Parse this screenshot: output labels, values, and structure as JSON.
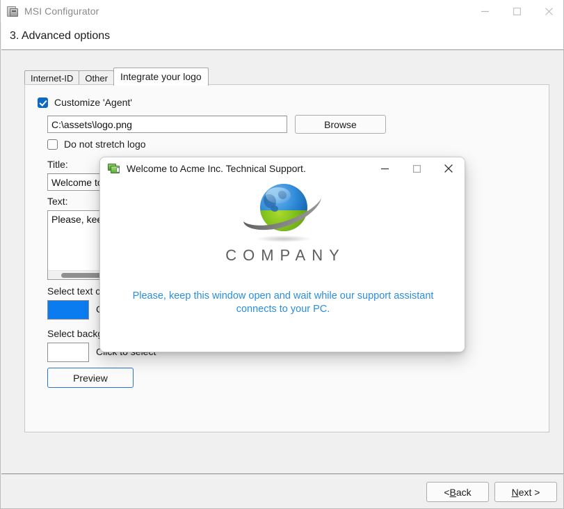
{
  "window": {
    "title": "MSI Configurator",
    "icon": "msi-installer-icon",
    "controls": {
      "minimize": "—",
      "maximize": "☐",
      "close": "✕"
    }
  },
  "header": {
    "step_title": "3. Advanced options"
  },
  "tabs": [
    {
      "label": "Internet-ID",
      "active": false
    },
    {
      "label": "Other",
      "active": false
    },
    {
      "label": "Integrate your logo",
      "active": true
    }
  ],
  "form": {
    "customize_agent": {
      "label": "Customize 'Agent'",
      "checked": true
    },
    "logo_path": {
      "value": "C:\\assets\\logo.png"
    },
    "browse_button": "Browse",
    "do_not_stretch": {
      "label": "Do not stretch logo",
      "checked": false
    },
    "title_label": "Title:",
    "title_value": "Welcome to Acme Inc. Technical Support.",
    "text_label": "Text:",
    "text_value": "Please, keep this window open and wait while our support assistant connects to your PC.",
    "text_color_label": "Select text color:",
    "text_color_value": "#0a7cf0",
    "text_color_action": "Click to select",
    "background_color_label": "Select background color:",
    "background_color_value": "#ffffff",
    "background_color_action": "Click to select",
    "preview_button": "Preview"
  },
  "footer": {
    "back_button": {
      "prefix": "< ",
      "mnemonic": "B",
      "suffix": "ack"
    },
    "next_button": {
      "prefix": "",
      "mnemonic": "N",
      "suffix": "ext >"
    }
  },
  "dialog": {
    "title": "Welcome to Acme Inc. Technical Support.",
    "icon": "remote-desktop-icon",
    "controls": {
      "minimize": "—",
      "maximize": "☐",
      "close": "✕"
    },
    "logo": {
      "wordmark": "COMPANY",
      "graphic": "globe-swoosh-logo"
    },
    "message": "Please, keep this window open and wait while our support assistant connects to your PC.",
    "message_color": "#2a8de0"
  }
}
